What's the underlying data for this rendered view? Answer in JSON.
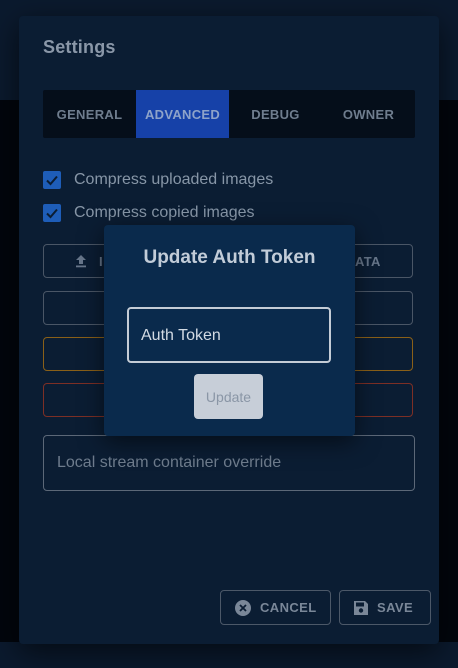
{
  "settings": {
    "title": "Settings",
    "tabs": [
      {
        "label": "GENERAL",
        "active": false
      },
      {
        "label": "ADVANCED",
        "active": true
      },
      {
        "label": "DEBUG",
        "active": false
      },
      {
        "label": "OWNER",
        "active": false
      }
    ],
    "checkboxes": [
      {
        "label": "Compress uploaded images",
        "checked": true
      },
      {
        "label": "Compress copied images",
        "checked": true
      }
    ],
    "buttons": {
      "import_partial": "I",
      "export_data_partial": "ATA"
    },
    "stream_container": {
      "placeholder": "Local stream container override"
    },
    "footer": {
      "cancel_label": "CANCEL",
      "save_label": "SAVE"
    }
  },
  "popup": {
    "title": "Update Auth Token",
    "token_field": {
      "value": "Auth Token"
    },
    "update_label": "Update"
  },
  "colors": {
    "accent": "#1641a8",
    "checkbox": "#1e5db8",
    "warning_border": "#8a6018",
    "danger_border": "#7d2f25",
    "popup_bg": "#0a2a4c"
  },
  "icons": {
    "checkbox": "check-icon",
    "import": "upload-icon",
    "cancel": "close-circle-icon",
    "save": "floppy-disk-icon"
  }
}
